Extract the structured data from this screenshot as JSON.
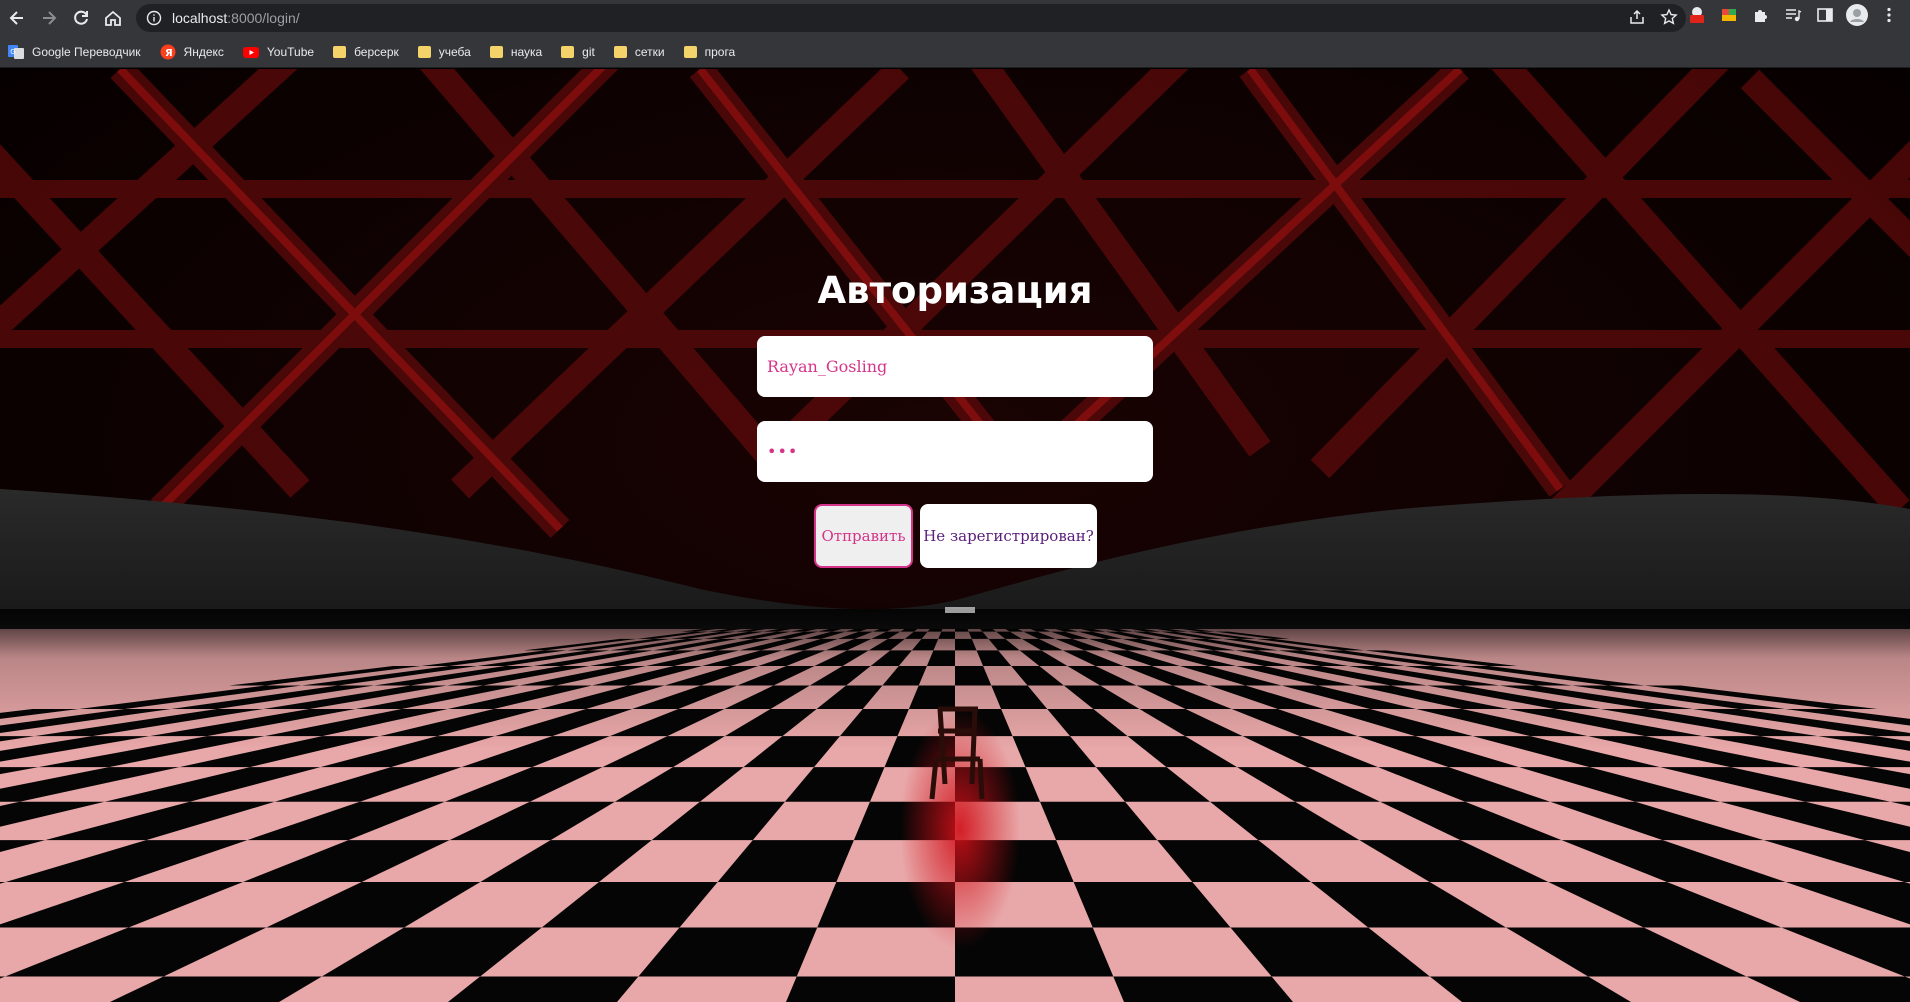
{
  "browser": {
    "url_host": "localhost",
    "url_path": ":8000/login/",
    "bookmarks": [
      {
        "label": "Google Переводчик",
        "icon": "google-translate-icon"
      },
      {
        "label": "Яндекс",
        "icon": "yandex-icon"
      },
      {
        "label": "YouTube",
        "icon": "youtube-icon"
      },
      {
        "label": "берсерк",
        "icon": "folder-icon"
      },
      {
        "label": "учеба",
        "icon": "folder-icon"
      },
      {
        "label": "наука",
        "icon": "folder-icon"
      },
      {
        "label": "git",
        "icon": "folder-icon"
      },
      {
        "label": "сетки",
        "icon": "folder-icon"
      },
      {
        "label": "прога",
        "icon": "folder-icon"
      }
    ]
  },
  "auth": {
    "title": "Авторизация",
    "username_value": "Rayan_Gosling",
    "password_value": "•••",
    "submit_label": "Отправить",
    "register_label": "Не зарегистрирован?"
  },
  "colors": {
    "accent": "#d4348a",
    "register_text": "#5a1d7a",
    "chrome_bg": "#35363a",
    "omnibox_bg": "#202124"
  }
}
